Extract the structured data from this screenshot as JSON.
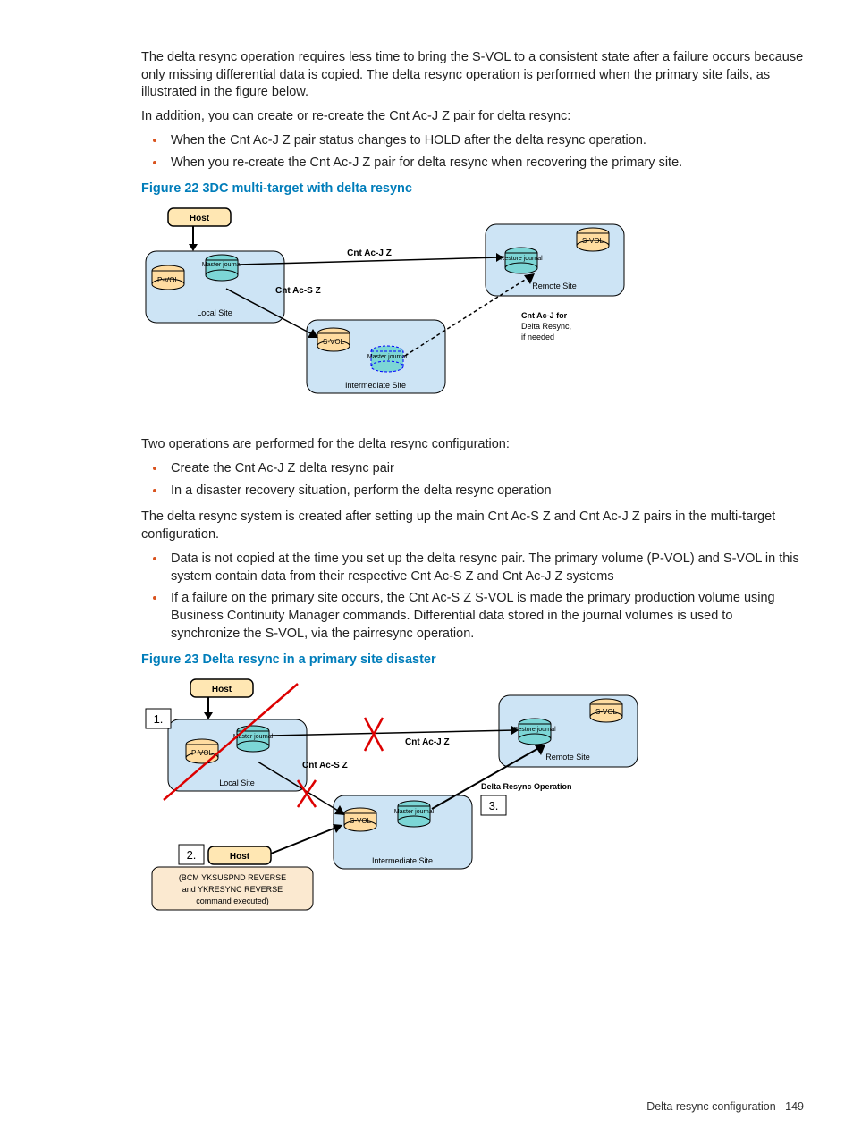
{
  "para1": "The delta resync operation requires less time to bring the S-VOL to a consistent state after a failure occurs because only missing differential data is copied. The delta resync operation is performed when the primary site fails, as illustrated in the figure below.",
  "para2": "In addition, you can create or re-create the Cnt Ac-J Z pair for delta resync:",
  "list1_a": "When the Cnt Ac-J Z pair status changes to HOLD after the delta resync operation.",
  "list1_b": "When you re-create the Cnt Ac-J Z pair for delta resync when recovering the primary site.",
  "fig22_caption": "Figure 22 3DC multi-target with delta resync",
  "para3": "Two operations are performed for the delta resync configuration:",
  "list2_a": "Create the Cnt Ac-J Z delta resync pair",
  "list2_b": "In a disaster recovery situation, perform the delta resync operation",
  "para4": "The delta resync system is created after setting up the main Cnt Ac-S Z and Cnt Ac-J Z pairs in the multi-target configuration.",
  "list3_a": "Data is not copied at the time you set up the delta resync pair. The primary volume (P-VOL) and S-VOL in this system contain data from their respective Cnt Ac-S Z and Cnt Ac-J Z systems",
  "list3_b": "If a failure on the primary site occurs, the Cnt Ac-S Z S-VOL is made the primary production volume using Business Continuity Manager commands. Differential data stored in the journal volumes is used to synchronize the S-VOL, via the pairresync operation.",
  "fig23_caption": "Figure 23 Delta resync in a primary site disaster",
  "footer_text": "Delta resync configuration",
  "footer_page": "149",
  "diag22": {
    "host": "Host",
    "pvol": "P-VOL",
    "master": "Master journal",
    "local": "Local Site",
    "acjz": "Cnt Ac-J Z",
    "acsz": "Cnt Ac-S Z",
    "svol": "S-VOL",
    "restore": "Restore journal",
    "remote": "Remote Site",
    "intermediate": "Intermediate Site",
    "delta1": "Cnt Ac-J for",
    "delta2": "Delta Resync,",
    "delta3": "if needed"
  },
  "diag23": {
    "host": "Host",
    "pvol": "P-VOL",
    "master": "Master journal",
    "local": "Local Site",
    "acjz": "Cnt Ac-J Z",
    "acsz": "Cnt Ac-S Z",
    "svol": "S-VOL",
    "restore": "Restore journal",
    "remote": "Remote Site",
    "intermediate": "Intermediate Site",
    "delta_op": "Delta Resync Operation",
    "host2": "Host",
    "bcm1": "(BCM YKSUSPND REVERSE",
    "bcm2": "and YKRESYNC REVERSE",
    "bcm3": "command executed)",
    "n1": "1.",
    "n2": "2.",
    "n3": "3."
  }
}
